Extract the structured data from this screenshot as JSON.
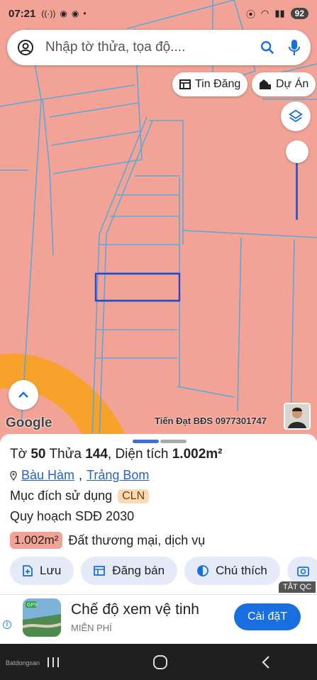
{
  "status_bar": {
    "time": "07:21",
    "battery": "92",
    "left_icons": [
      "wifi-calling-icon",
      "messenger-icon",
      "messenger-icon",
      "dot-icon"
    ],
    "right_icons": [
      "location-icon",
      "hotspot-icon",
      "wifi-icon",
      "signal-icon",
      "signal-icon"
    ]
  },
  "search": {
    "placeholder": "Nhập tờ thửa, tọa độ....",
    "left_icon": "account-icon",
    "icons": [
      "search-icon",
      "mic-icon"
    ]
  },
  "chips": [
    {
      "label": "Tin Đăng",
      "icon": "listing-icon"
    },
    {
      "label": "Dự Án",
      "icon": "project-icon"
    }
  ],
  "map": {
    "brand": "Google",
    "watermark": "Tiến Đạt BĐS 0977301747",
    "layer_icon": "layers-icon",
    "up_icon": "chevron-up-icon",
    "colors": {
      "land": "#f3a396",
      "parcel_line": "#5aa9d8",
      "selected": "#2d47c7",
      "road": "#f6a22b"
    }
  },
  "parcel": {
    "sheet_label": "Tờ",
    "sheet_no": "50",
    "plot_label": "Thửa",
    "plot_no": "144",
    "area_label": "Diện tích",
    "area": "1.002m²",
    "commune": "Bàu Hàm",
    "district": "Trảng Bom",
    "usage_label": "Mục đích sử dụng",
    "usage_code": "CLN",
    "planning_label": "Quy hoạch SDĐ 2030",
    "planning_area": "1.002m²",
    "planning_use": "Đất thương mại, dịch vụ"
  },
  "actions": [
    {
      "label": "Lưu",
      "icon": "save-icon"
    },
    {
      "label": "Đăng bán",
      "icon": "sell-icon"
    },
    {
      "label": "Chú thích",
      "icon": "legend-icon"
    },
    {
      "label": "",
      "icon": "camera-icon"
    }
  ],
  "ad": {
    "close_label": "TẮT QC",
    "title": "Chế độ xem vệ tinh",
    "subtitle": "MIỄN PHÍ",
    "button": "Cài đặT",
    "app_logo_text": "GPS"
  },
  "nav": {
    "brand": "Batdongsan",
    "icons": [
      "recents-icon",
      "home-icon",
      "back-icon"
    ]
  }
}
